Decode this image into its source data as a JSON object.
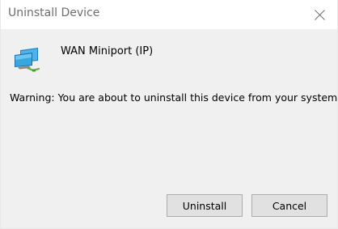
{
  "window": {
    "title": "Uninstall Device"
  },
  "device": {
    "name": "WAN Miniport (IP)",
    "icon": "network-adapter-icon"
  },
  "message": {
    "warning": "Warning: You are about to uninstall this device from your system."
  },
  "buttons": {
    "uninstall_label": "Uninstall",
    "cancel_label": "Cancel"
  },
  "colors": {
    "title_text": "#6d6d6d",
    "body_background": "#f0f0f0",
    "titlebar_background": "#ffffff",
    "button_background": "#e1e1e1",
    "button_border": "#adadad",
    "icon_blue": "#2f9bd6",
    "icon_green": "#5fb13a"
  }
}
